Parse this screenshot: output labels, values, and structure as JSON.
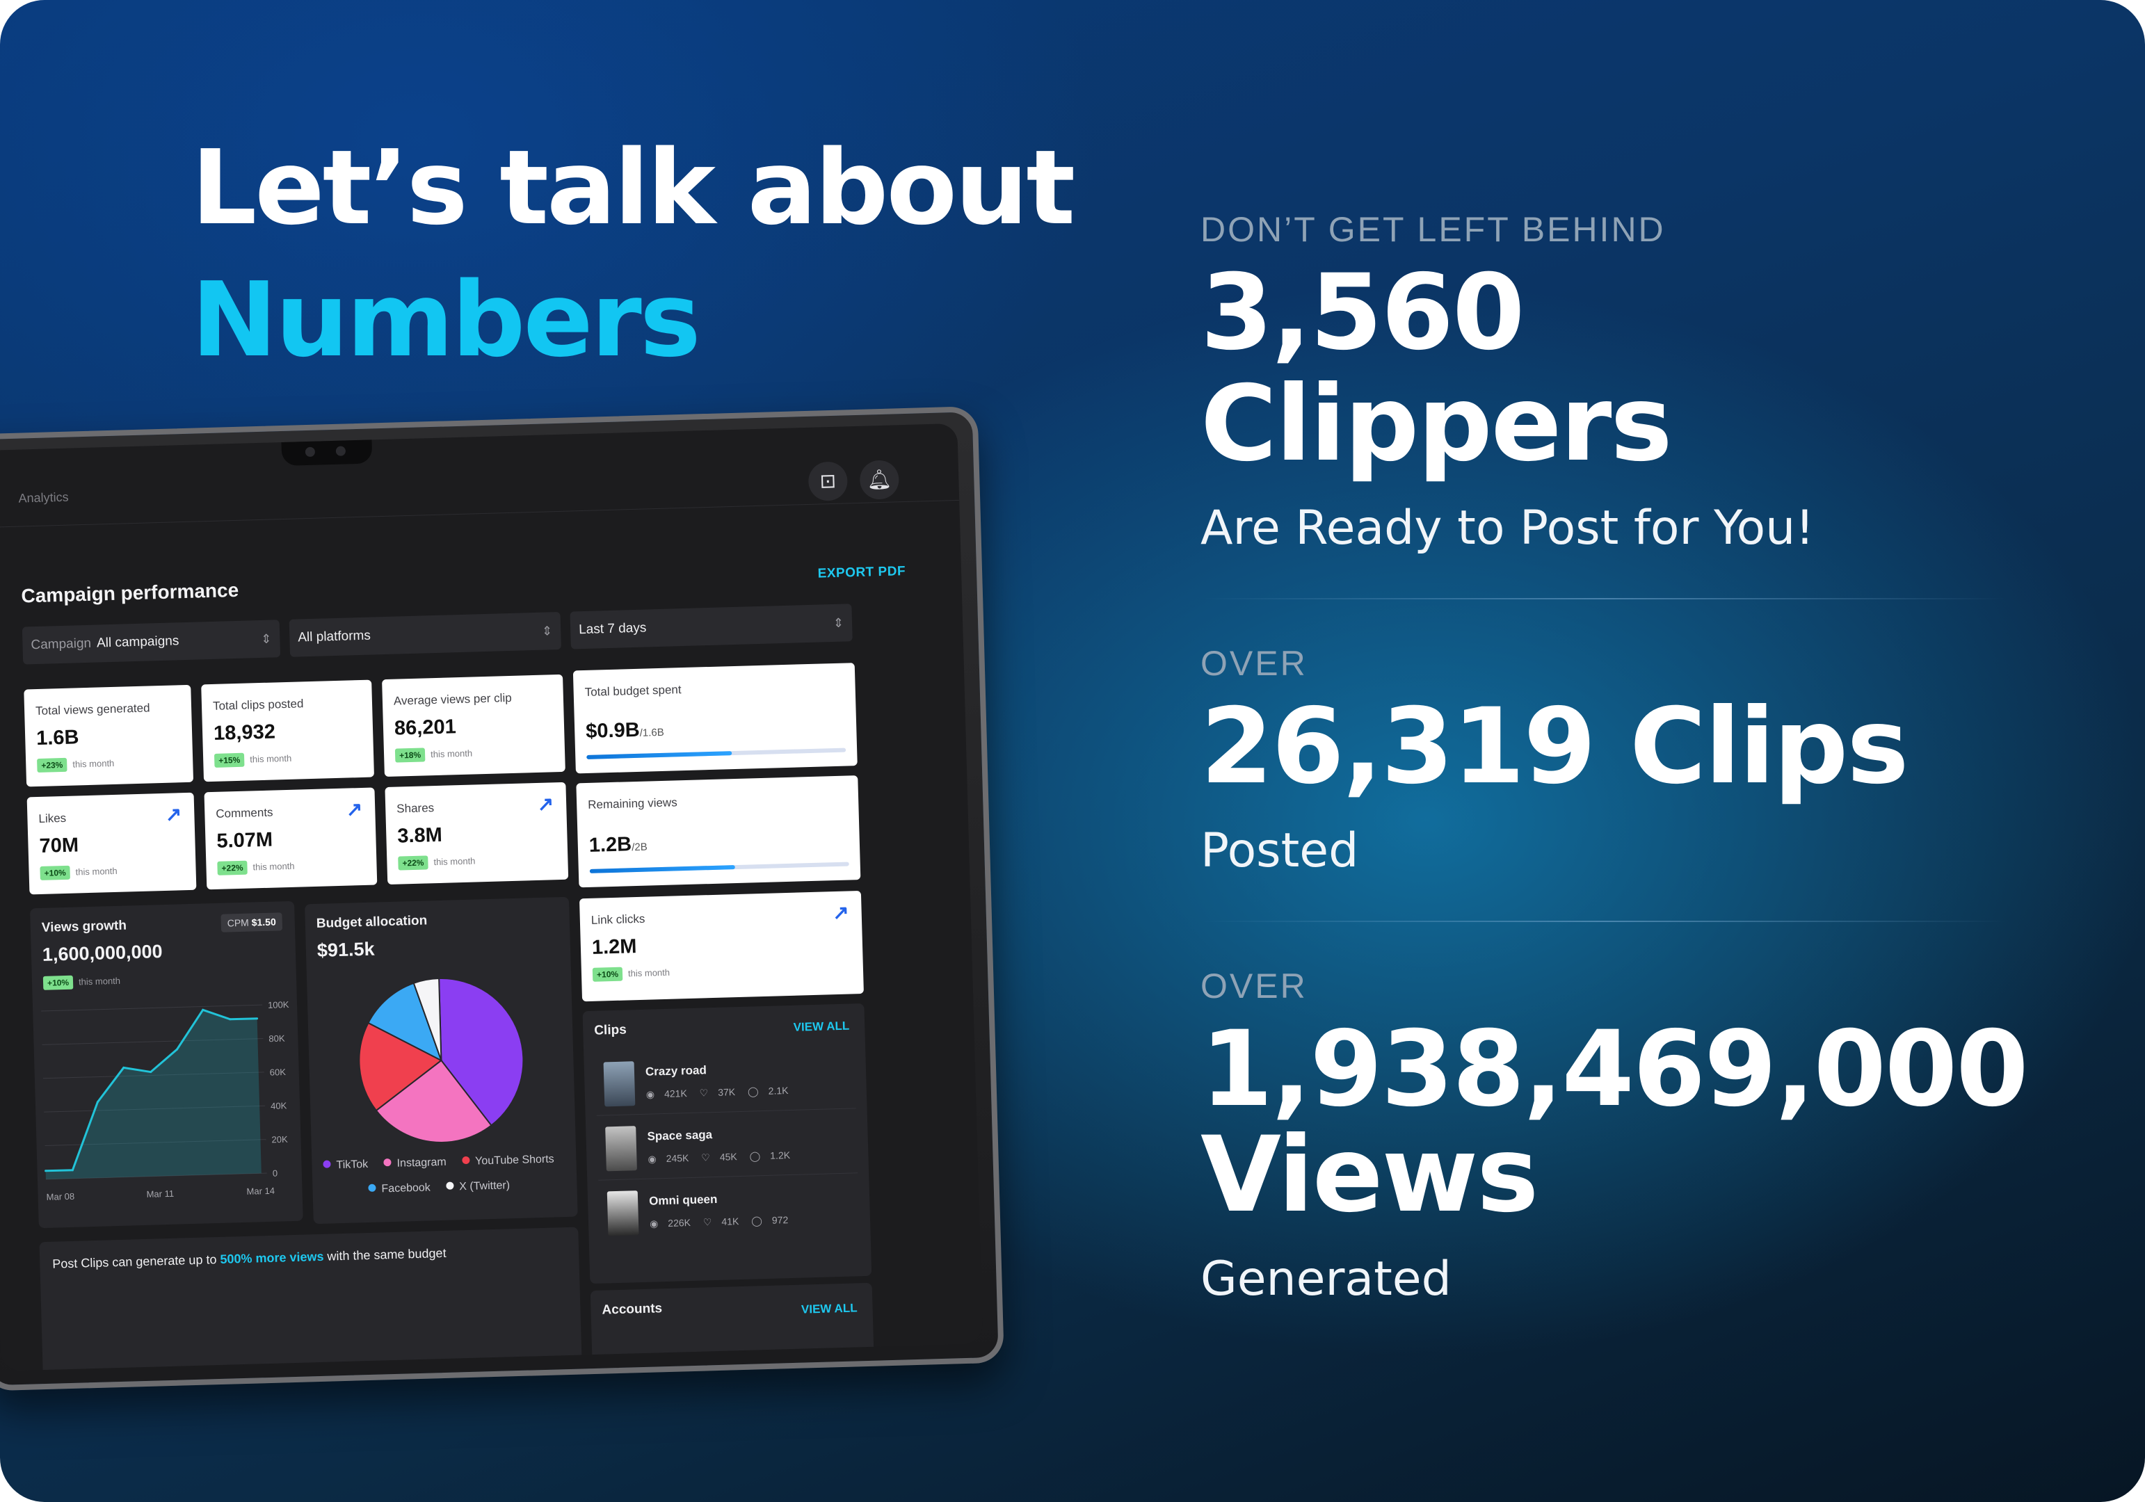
{
  "hero": {
    "line1": "Let’s talk about",
    "line2": "Numbers"
  },
  "stats": [
    {
      "eyebrow": "DON’T GET LEFT BEHIND",
      "headline": "3,560 Clippers",
      "sub": "Are Ready to Post for You!"
    },
    {
      "eyebrow": "OVER",
      "headline": "26,319 Clips",
      "sub": "Posted"
    },
    {
      "eyebrow": "OVER",
      "headline_line1": "1,938,469,000",
      "headline_line2": "Views",
      "sub": "Generated"
    }
  ],
  "dashboard": {
    "breadcrumb": "Analytics",
    "header_icons": [
      "alert-icon",
      "bell-icon"
    ],
    "title": "Campaign performance",
    "export_label": "EXPORT PDF",
    "filters": {
      "campaign_label": "Campaign",
      "campaign_value": "All campaigns",
      "platform_value": "All platforms",
      "range_value": "Last 7 days"
    },
    "cards": {
      "views": {
        "label": "Total views generated",
        "value": "1.6B",
        "badge": "+23%",
        "period": "this month"
      },
      "clips": {
        "label": "Total clips posted",
        "value": "18,932",
        "badge": "+15%",
        "period": "this month"
      },
      "avg": {
        "label": "Average views per clip",
        "value": "86,201",
        "badge": "+18%",
        "period": "this month"
      },
      "budget": {
        "label": "Total budget spent",
        "value": "$0.9B",
        "total": "/1.6B",
        "progress": 0.56
      },
      "likes": {
        "label": "Likes",
        "value": "70M",
        "badge": "+10%",
        "period": "this month"
      },
      "comments": {
        "label": "Comments",
        "value": "5.07M",
        "badge": "+22%",
        "period": "this month"
      },
      "shares": {
        "label": "Shares",
        "value": "3.8M",
        "badge": "+22%",
        "period": "this month"
      },
      "remaining": {
        "label": "Remaining views",
        "value": "1.2B",
        "total": "/2B",
        "progress": 0.56
      },
      "link_clicks": {
        "label": "Link clicks",
        "value": "1.2M",
        "badge": "+10%",
        "period": "this month"
      }
    },
    "views_growth": {
      "title": "Views growth",
      "value": "1,600,000,000",
      "badge": "+10%",
      "period": "this month",
      "cpm_label": "CPM",
      "cpm_value": "$1.50"
    },
    "budget_allocation": {
      "title": "Budget allocation",
      "value": "$91.5k"
    },
    "clips": {
      "title": "Clips",
      "view_all": "VIEW ALL",
      "items": [
        {
          "name": "Crazy road",
          "views": "421K",
          "likes": "37K",
          "comments": "2.1K"
        },
        {
          "name": "Space saga",
          "views": "245K",
          "likes": "45K",
          "comments": "1.2K"
        },
        {
          "name": "Omni queen",
          "views": "226K",
          "likes": "41K",
          "comments": "972"
        }
      ]
    },
    "accounts": {
      "title": "Accounts",
      "view_all": "VIEW ALL"
    },
    "promo": {
      "prefix": "Post Clips can generate up to",
      "highlight": "500% more views",
      "suffix": "with the same budget"
    }
  },
  "chart_data": [
    {
      "type": "area",
      "x": [
        "Mar 08",
        "",
        "",
        "Mar 11",
        "",
        "",
        "Mar 14"
      ],
      "x_tick_labels": [
        "Mar 08",
        "Mar 11",
        "Mar 14"
      ],
      "values": [
        5,
        5,
        45,
        65,
        62,
        75,
        98,
        92,
        92
      ],
      "y_tick_labels": [
        "100K",
        "80K",
        "60K",
        "40K",
        "20K",
        "0"
      ],
      "ylim": [
        0,
        100
      ],
      "grid": true,
      "color": "#22c3d8"
    },
    {
      "type": "pie",
      "labels": [
        "TikTok",
        "Instagram",
        "YouTube Shorts",
        "Facebook",
        "X (Twitter)"
      ],
      "values": [
        40,
        25,
        18,
        12,
        5
      ],
      "colors": [
        "#8b3ef2",
        "#f474c0",
        "#f0404e",
        "#3ba9f4",
        "#f5f5f7"
      ]
    }
  ]
}
